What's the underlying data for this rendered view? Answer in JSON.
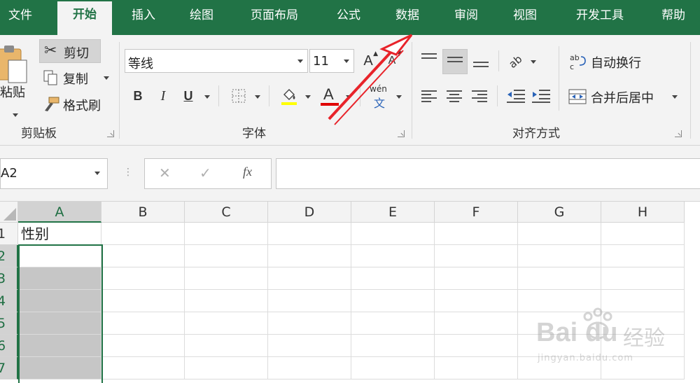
{
  "tabs": [
    {
      "label": "文件",
      "active": false
    },
    {
      "label": "开始",
      "active": true
    },
    {
      "label": "插入",
      "active": false
    },
    {
      "label": "绘图",
      "active": false
    },
    {
      "label": "页面布局",
      "active": false
    },
    {
      "label": "公式",
      "active": false
    },
    {
      "label": "数据",
      "active": false
    },
    {
      "label": "审阅",
      "active": false
    },
    {
      "label": "视图",
      "active": false
    },
    {
      "label": "开发工具",
      "active": false
    },
    {
      "label": "帮助",
      "active": false
    }
  ],
  "ribbon": {
    "clipboard": {
      "group_label": "剪贴板",
      "paste_label": "粘贴",
      "cut_label": "剪切",
      "copy_label": "复制",
      "format_painter_label": "格式刷"
    },
    "font": {
      "group_label": "字体",
      "font_name": "等线",
      "font_size": "11",
      "bold": "B",
      "italic": "I",
      "underline": "U",
      "increase_size": "A",
      "decrease_size": "A",
      "font_color_glyph": "A",
      "phonetic_top": "wén",
      "phonetic_bottom": "文",
      "fill_color": "#ffff00",
      "font_color": "#e00000"
    },
    "alignment": {
      "group_label": "对齐方式",
      "orientation_glyph": "ab",
      "wrap_text_label": "自动换行",
      "merge_center_label": "合并后居中"
    }
  },
  "formula_bar": {
    "name_box": "A2",
    "cancel": "✕",
    "enter": "✓",
    "fx": "fx",
    "formula": ""
  },
  "grid": {
    "columns": [
      "A",
      "B",
      "C",
      "D",
      "E",
      "F",
      "G",
      "H"
    ],
    "rows": [
      "1",
      "2",
      "3",
      "4",
      "5",
      "6",
      "7"
    ],
    "cells": {
      "A1": "性别"
    },
    "selected_column": "A",
    "active_cell": "A2"
  },
  "watermark": {
    "brand_latin": "Bai",
    "brand_latin2": "du",
    "brand_cn": "经验",
    "url": "jingyan.baidu.com"
  },
  "colors": {
    "accent": "#217346",
    "annotation_arrow": "#e8232a"
  }
}
